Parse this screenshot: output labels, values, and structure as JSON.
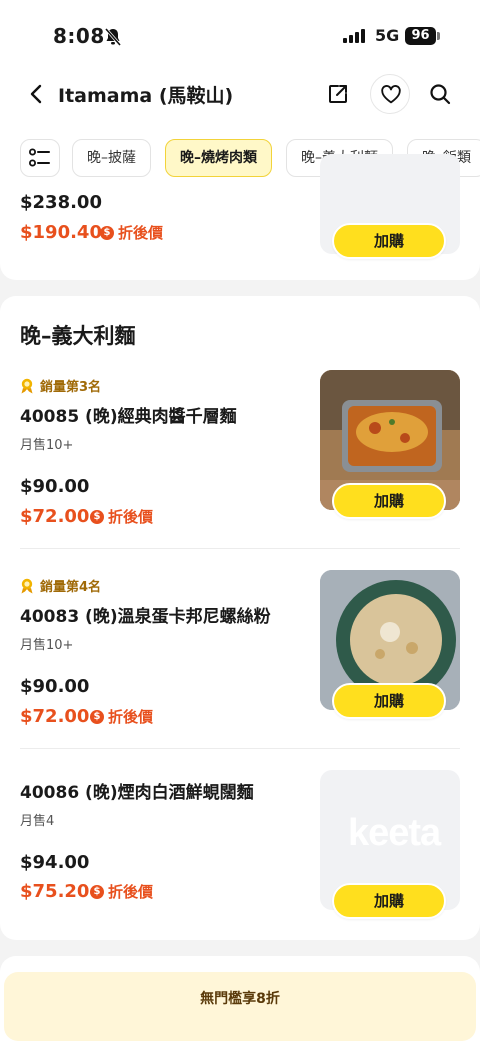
{
  "status_bar": {
    "time": "8:08",
    "network": "5G",
    "battery": "96"
  },
  "nav": {
    "title": "Itamama (馬鞍山)"
  },
  "tabs": [
    {
      "label": "晚–披薩",
      "active": false
    },
    {
      "label": "晚–燒烤肉類",
      "active": true
    },
    {
      "label": "晚–義大利麵",
      "active": false
    },
    {
      "label": "晚–飯類",
      "active": false
    }
  ],
  "top_item": {
    "price": "$238.00",
    "discount_price": "$190.40",
    "discount_label": "折後價",
    "add_label": "加購"
  },
  "section": {
    "title": "晚–義大利麵",
    "items": [
      {
        "rank": "銷量第3名",
        "name": "40085 (晚)經典肉醬千層麵",
        "monthly": "月售10+",
        "price": "$90.00",
        "discount_price": "$72.00",
        "discount_label": "折後價",
        "add_label": "加購"
      },
      {
        "rank": "銷量第4名",
        "name": "40083 (晚)溫泉蛋卡邦尼螺絲粉",
        "monthly": "月售10+",
        "price": "$90.00",
        "discount_price": "$72.00",
        "discount_label": "折後價",
        "add_label": "加購"
      },
      {
        "name": "40086 (晚)煙肉白酒鮮蜆闊麵",
        "monthly": "月售4",
        "price": "$94.00",
        "discount_price": "$75.20",
        "discount_label": "折後價",
        "add_label": "加購",
        "placeholder_logo": "keeta"
      }
    ]
  },
  "promo": {
    "text": "無門檻享8折"
  },
  "colors": {
    "accent_yellow": "#ffdf1e",
    "discount_orange": "#e8501d",
    "rank_gold": "#a06a08"
  },
  "icons": [
    "bell-off-icon",
    "signal-icon",
    "back-icon",
    "share-icon",
    "heart-icon",
    "search-icon",
    "menu-list-icon",
    "coin-icon",
    "medal-icon"
  ]
}
